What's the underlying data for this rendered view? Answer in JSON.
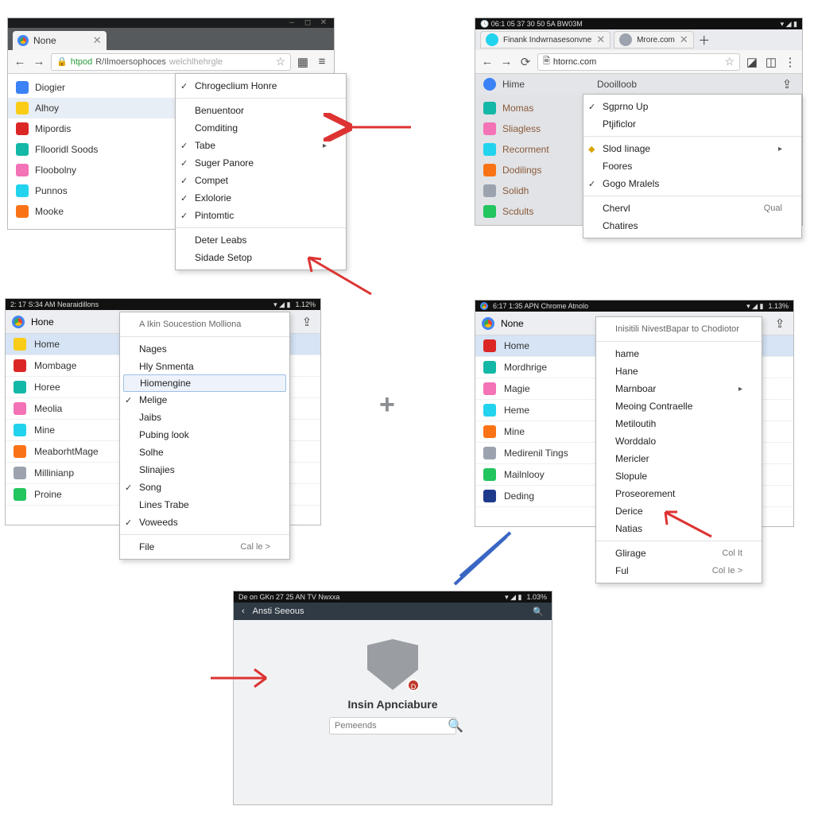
{
  "panel1": {
    "tab_title": "None",
    "url_proto": "htpod",
    "url_host": "R/Ilmoersophoces",
    "url_q": "welchlhehrgle",
    "bookmarks": [
      {
        "label": "Diogier"
      },
      {
        "label": "Alhoy"
      },
      {
        "label": "Mipordis"
      },
      {
        "label": "Fllooridl Soods"
      },
      {
        "label": "Floobolny"
      },
      {
        "label": "Punnos"
      },
      {
        "label": "Mooke"
      }
    ]
  },
  "menu1": {
    "items": [
      {
        "label": "Chrogeclium Honre",
        "check": true
      },
      {
        "sep": true
      },
      {
        "label": "Benuentoor"
      },
      {
        "label": "Comditing"
      },
      {
        "label": "Tabe",
        "check": true,
        "submenu": true
      },
      {
        "label": "Suger Panore",
        "check": true
      },
      {
        "label": "Compet",
        "check": true
      },
      {
        "label": "Exlolorie",
        "check": true
      },
      {
        "label": "Pintomtic",
        "check": true
      },
      {
        "sep": true
      },
      {
        "label": "Deter Leabs"
      },
      {
        "label": "Sidade Setop"
      }
    ]
  },
  "panel2": {
    "tab1": "Finank Indwrnasesonvne",
    "tab2": "Mrore.com",
    "url": "htornc.com",
    "header_left": "Hime",
    "header_right": "Dooilloob",
    "left": [
      {
        "label": "Momas"
      },
      {
        "label": "Sliagless"
      },
      {
        "label": "Recorment"
      },
      {
        "label": "Dodilings"
      },
      {
        "label": "Solidh"
      },
      {
        "label": "Scdults"
      }
    ]
  },
  "menu2": {
    "items": [
      {
        "label": "Sgprno Up",
        "check": true
      },
      {
        "label": "Ptjificlor"
      },
      {
        "sep": true
      },
      {
        "label": "Slod Iinage",
        "icon": true,
        "submenu": true
      },
      {
        "label": "Foores"
      },
      {
        "label": "Gogo Mralels",
        "check": true
      },
      {
        "sep": true
      },
      {
        "label": "Chervl",
        "kbd": "Qual"
      },
      {
        "label": "Chatires"
      }
    ]
  },
  "panel3": {
    "status_left": "2: 17 S:34 AM Nearaidillons",
    "status_right": "1.12%",
    "top_label": "Hone",
    "left": [
      {
        "label": "Home",
        "sel": true
      },
      {
        "label": "Mombage"
      },
      {
        "label": "Horee"
      },
      {
        "label": "Meolia"
      },
      {
        "label": "Mine"
      },
      {
        "label": "MeaborhtMage"
      },
      {
        "label": "Millinianp"
      },
      {
        "label": "Proine"
      }
    ]
  },
  "menu3": {
    "header": "A Ikin Soucestion Molliona",
    "items": [
      {
        "label": "Nages"
      },
      {
        "label": "Hly Snmenta"
      },
      {
        "label": "Hiomengine",
        "hover": true
      },
      {
        "label": "Melige",
        "check": true
      },
      {
        "label": "Jaibs"
      },
      {
        "label": "Pubing look"
      },
      {
        "label": "Solhe"
      },
      {
        "label": "Slinajies"
      },
      {
        "label": "Song",
        "check": true
      },
      {
        "label": "Lines Trabe"
      },
      {
        "label": "Voweeds",
        "check": true
      },
      {
        "sep": true
      },
      {
        "label": "File",
        "kbd": "Cal le >"
      }
    ]
  },
  "panel4": {
    "status_left": "6:17 1:35 APN Chrome Atnolo",
    "status_right": "1.13%",
    "top_label": "None",
    "left": [
      {
        "label": "Home",
        "sel": true
      },
      {
        "label": "Mordhrige"
      },
      {
        "label": "Magie"
      },
      {
        "label": "Heme"
      },
      {
        "label": "Mine"
      },
      {
        "label": "Medirenil Tings"
      },
      {
        "label": "Mailnlooy"
      },
      {
        "label": "Deding"
      }
    ]
  },
  "menu4": {
    "header1": "Inisitili NivestBapar to Chodiotor",
    "items": [
      {
        "label": "hame"
      },
      {
        "label": "Hane"
      },
      {
        "label": "Marnboar",
        "submenu": true
      },
      {
        "label": "Meoing Contraelle"
      },
      {
        "label": "Metiloutih"
      },
      {
        "label": "Worddalo"
      },
      {
        "label": "Mericler"
      },
      {
        "label": "Slopule"
      },
      {
        "label": "Proseorement"
      },
      {
        "label": "Derice"
      },
      {
        "label": "Natias"
      },
      {
        "sep": true
      },
      {
        "label": "Glirage",
        "kbd": "Col It"
      },
      {
        "label": "Ful",
        "kbd": "Col Ie >"
      }
    ]
  },
  "panel5": {
    "status_left": "De on GKn 27 25 AN TV Nwxxa",
    "status_right": "1.03%",
    "bar_back": "Ansti Seeous",
    "title": "Insin Apnciabure",
    "search_ph": "Pemeends"
  }
}
